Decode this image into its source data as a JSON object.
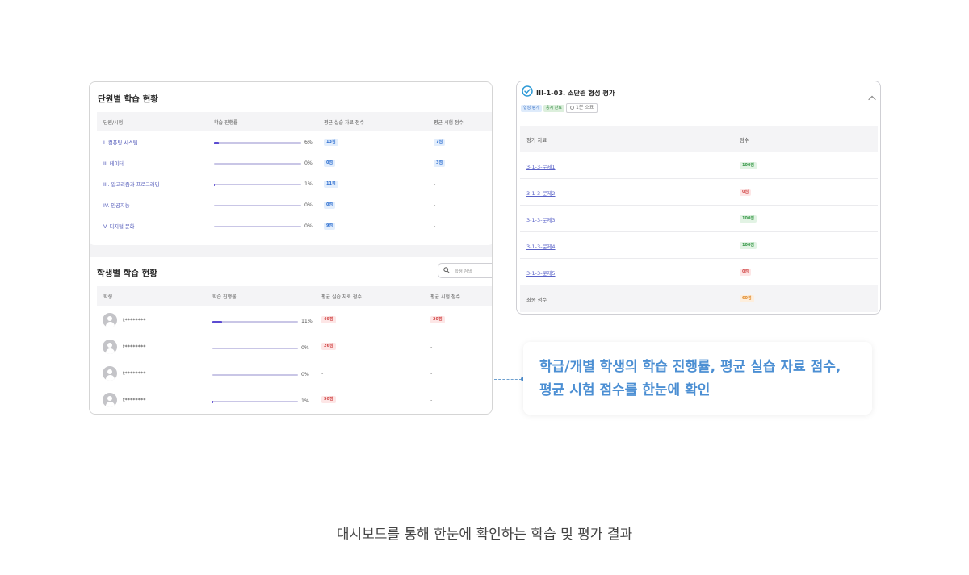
{
  "unit_panel": {
    "title": "단원별 학습 현황",
    "headers": [
      "단원/시험",
      "학습 진행률",
      "평균 실습 자료 점수",
      "평균 시험 점수"
    ],
    "rows": [
      {
        "name": "I. 컴퓨팅 시스템",
        "progress": 6,
        "progress_text": "6%",
        "practice": "13점",
        "exam": "7점"
      },
      {
        "name": "II. 데이터",
        "progress": 0,
        "progress_text": "0%",
        "practice": "0점",
        "exam": "3점"
      },
      {
        "name": "III. 알고리즘과 프로그래밍",
        "progress": 1,
        "progress_text": "1%",
        "practice": "11점",
        "exam": "-"
      },
      {
        "name": "IV. 인공지능",
        "progress": 0,
        "progress_text": "0%",
        "practice": "0점",
        "exam": "-"
      },
      {
        "name": "V. 디지털 문화",
        "progress": 0,
        "progress_text": "0%",
        "practice": "9점",
        "exam": "-"
      }
    ]
  },
  "student_panel": {
    "title": "학생별 학습 현황",
    "search_placeholder": "학생 검색",
    "headers": [
      "학생",
      "학습 진행률",
      "평균 실습 자료 점수",
      "평균 시험 점수"
    ],
    "rows": [
      {
        "name": "t********",
        "progress": 11,
        "progress_text": "11%",
        "practice": "49점",
        "exam": "20점"
      },
      {
        "name": "t********",
        "progress": 0,
        "progress_text": "0%",
        "practice": "26점",
        "exam": "-"
      },
      {
        "name": "t********",
        "progress": 0,
        "progress_text": "0%",
        "practice": "-",
        "exam": "-"
      },
      {
        "name": "t********",
        "progress": 1,
        "progress_text": "1%",
        "practice": "50점",
        "exam": "-"
      }
    ]
  },
  "assessment_panel": {
    "title": "III-1-03. 소단원 형성 평가",
    "tags": [
      "형성 평가",
      "응시 완료"
    ],
    "time_tag": "1분 소요",
    "headers": [
      "평가 자료",
      "점수"
    ],
    "rows": [
      {
        "name": "3-1-3-문제1",
        "score": "100점",
        "status": "green"
      },
      {
        "name": "3-1-3-문제2",
        "score": "0점",
        "status": "red"
      },
      {
        "name": "3-1-3-문제3",
        "score": "100점",
        "status": "green"
      },
      {
        "name": "3-1-3-문제4",
        "score": "100점",
        "status": "green"
      },
      {
        "name": "3-1-3-문제5",
        "score": "0점",
        "status": "red"
      }
    ],
    "total_label": "최종 점수",
    "total_score": "60점"
  },
  "callout": {
    "line1": "학급/개별 학생의 학습 진행률, 평균 실습 자료 점수,",
    "line2": "평균 시험 점수를 한눈에 확인"
  },
  "caption": "대시보드를 통해 한눈에 확인하는 학습 및 평가 결과",
  "colors": {
    "accent_blue": "#4c8fd3",
    "progress": "#5b4bd1",
    "link": "#5a63c8"
  }
}
